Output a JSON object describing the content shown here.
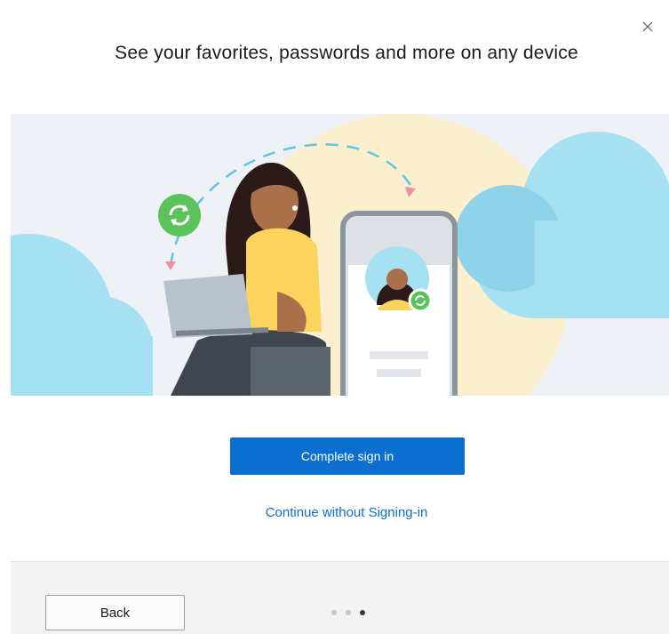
{
  "dialog": {
    "title": "See your favorites, passwords and more on any device",
    "close_icon": "close-icon"
  },
  "illustration": {
    "icons": [
      "sync-icon",
      "avatar-sync-icon"
    ],
    "colors": {
      "background": "#eef2f6",
      "cloud": "#a5e1f2",
      "sun": "#fbefce",
      "sync": "#5cc25a",
      "hair": "#2b1a17",
      "sweater": "#fcd35c",
      "dash": "#5ec5e5",
      "arrow": "#f38ea0"
    }
  },
  "actions": {
    "primary_label": "Complete sign in",
    "secondary_link": "Continue without Signing-in"
  },
  "footer": {
    "back_label": "Back",
    "pager": {
      "total": 3,
      "current": 3
    }
  },
  "colors": {
    "accent": "#0b6fd0",
    "footer_bg": "#f3f3f3"
  }
}
